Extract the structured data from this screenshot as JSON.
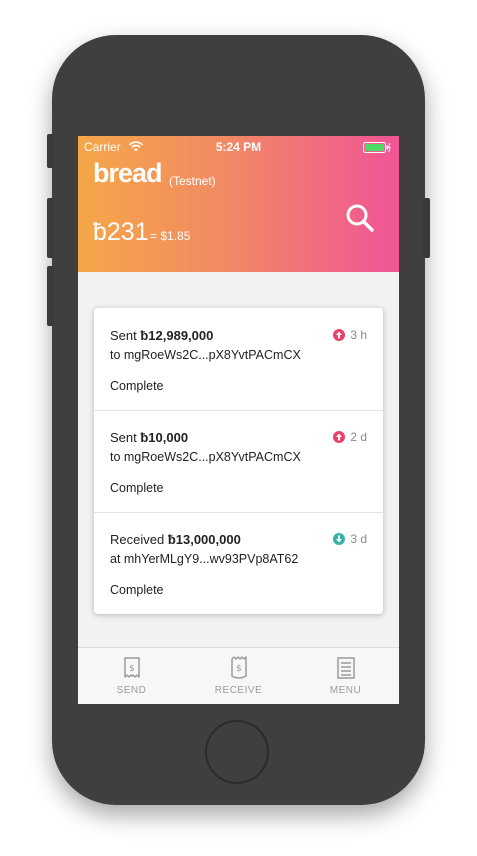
{
  "status_bar": {
    "carrier": "Carrier",
    "time": "5:24 PM"
  },
  "header": {
    "logo": "bread",
    "network": "(Testnet)",
    "balance": "ƀ231",
    "fiat": "= $1.85"
  },
  "transactions": [
    {
      "direction": "sent",
      "title_prefix": "Sent ",
      "amount": "ƀ12,989,000",
      "address": "to mgRoeWs2C...pX8YvtPACmCX",
      "status": "Complete",
      "age": "3 h",
      "color": "#e8416a"
    },
    {
      "direction": "sent",
      "title_prefix": "Sent ",
      "amount": "ƀ10,000",
      "address": "to mgRoeWs2C...pX8YvtPACmCX",
      "status": "Complete",
      "age": "2 d",
      "color": "#e8416a"
    },
    {
      "direction": "received",
      "title_prefix": "Received ",
      "amount": "ƀ13,000,000",
      "address": "at mhYerMLgY9...wv93PVp8AT62",
      "status": "Complete",
      "age": "3 d",
      "color": "#36b2a6"
    }
  ],
  "tabbar": {
    "send": "SEND",
    "receive": "RECEIVE",
    "menu": "MENU"
  },
  "colors": {
    "gradient_start": "#f4a748",
    "gradient_end": "#f05496",
    "sent": "#e8416a",
    "received": "#36b2a6"
  }
}
